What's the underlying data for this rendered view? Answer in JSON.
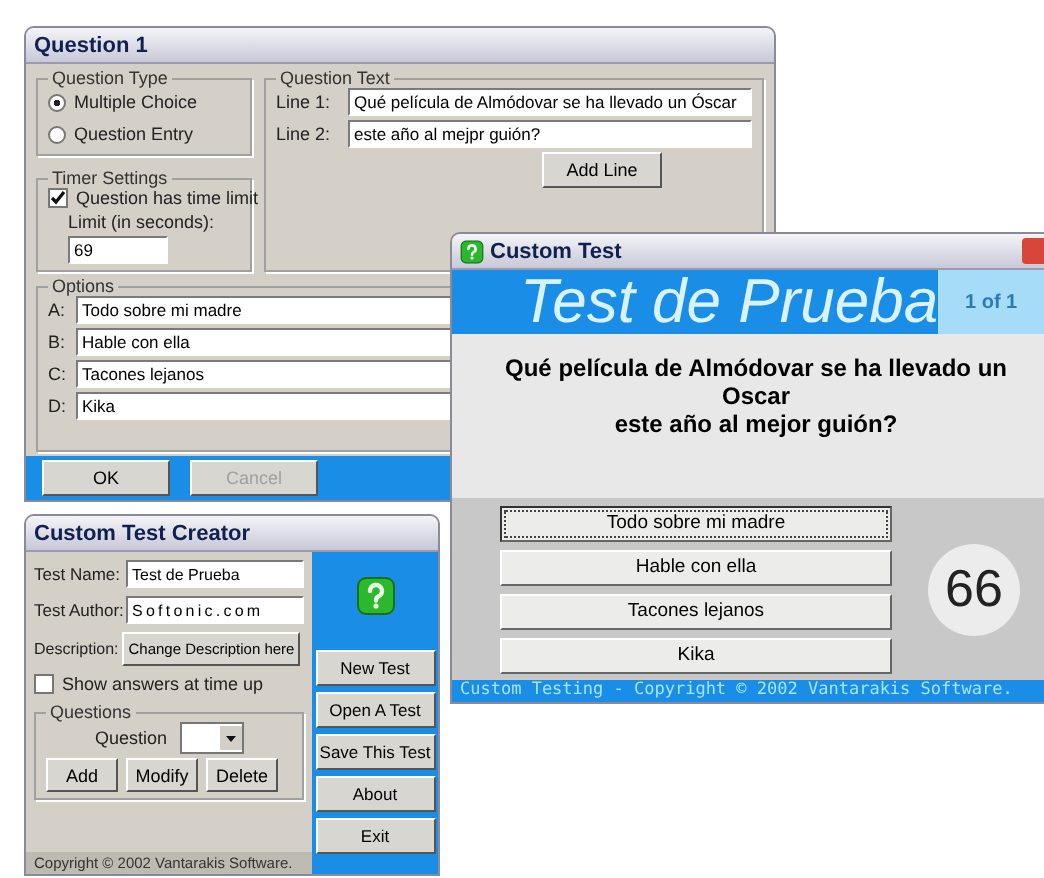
{
  "question_window": {
    "title": "Question 1",
    "question_type": {
      "label": "Question Type",
      "options": [
        {
          "label": "Multiple Choice",
          "selected": true
        },
        {
          "label": "Question Entry",
          "selected": false
        }
      ]
    },
    "question_text": {
      "label": "Question Text",
      "lines": [
        {
          "label": "Line 1:",
          "value": "Qué película de Almódovar se ha llevado un Óscar"
        },
        {
          "label": "Line 2:",
          "value": "este año al mejpr guión?"
        }
      ],
      "add_button": "Add Line"
    },
    "timer": {
      "label": "Timer Settings",
      "checkbox": {
        "label": "Question has time limit",
        "checked": true
      },
      "limit_label": "Limit (in seconds):",
      "limit_value": "69"
    },
    "options": {
      "label": "Options",
      "items": [
        {
          "letter": "A:",
          "value": "Todo sobre mi madre"
        },
        {
          "letter": "B:",
          "value": "Hable con ella"
        },
        {
          "letter": "C:",
          "value": "Tacones lejanos"
        },
        {
          "letter": "D:",
          "value": "Kika"
        }
      ]
    },
    "buttons": [
      {
        "label": "OK",
        "disabled": false
      },
      {
        "label": "Cancel",
        "disabled": true
      }
    ]
  },
  "test_window": {
    "title": "Custom Test",
    "test_name": "Test de Prueba",
    "counter": "1 of 1",
    "question_lines": [
      "Qué película de Almódovar se ha llevado un",
      "Oscar",
      "este año al mejor guión?"
    ],
    "answers": [
      {
        "label": "Todo sobre mi madre",
        "selected": true
      },
      {
        "label": "Hable con ella",
        "selected": false
      },
      {
        "label": "Tacones lejanos",
        "selected": false
      },
      {
        "label": "Kika",
        "selected": false
      }
    ],
    "time_left": "66",
    "status": "Custom Testing - Copyright © 2002 Vantarakis Software."
  },
  "creator_window": {
    "title": "Custom Test Creator",
    "fields": [
      {
        "label": "Test Name:",
        "value": "Test de Prueba",
        "kind": "plain"
      },
      {
        "label": "Test Author:",
        "value": "S o f t o n i c . c o m",
        "kind": "spaced"
      }
    ],
    "description_label": "Description:",
    "description_button": "Change Description here",
    "show_answers": {
      "label": "Show answers at time up",
      "checked": false
    },
    "questions": {
      "label": "Questions",
      "select_label": "Question",
      "buttons": [
        "Add",
        "Modify",
        "Delete"
      ]
    },
    "copyright": "Copyright © 2002 Vantarakis Software.",
    "side_buttons": [
      "New Test",
      "Open A Test",
      "Save This Test",
      "About",
      "Exit"
    ]
  }
}
